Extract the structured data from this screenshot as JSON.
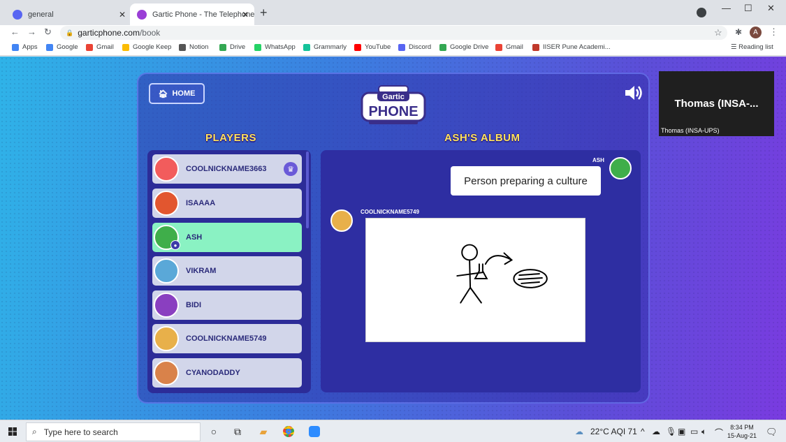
{
  "browser": {
    "tabs": [
      {
        "title": "general",
        "icon_color": "#5865f2",
        "active": false
      },
      {
        "title": "Gartic Phone - The Telephone Ga",
        "icon_color": "#9a3fd6",
        "active": true
      }
    ],
    "new_tab": "+",
    "url_host": "garticphone.com",
    "url_path": "/book",
    "profile_initial": "A",
    "bookmarks": [
      {
        "label": "Apps",
        "color": "#4285f4"
      },
      {
        "label": "Google",
        "color": "#4285f4"
      },
      {
        "label": "Gmail",
        "color": "#ea4335"
      },
      {
        "label": "Google Keep",
        "color": "#fbbc04"
      },
      {
        "label": "Notion",
        "color": "#555555"
      },
      {
        "label": "Drive",
        "color": "#34a853"
      },
      {
        "label": "WhatsApp",
        "color": "#25d366"
      },
      {
        "label": "Grammarly",
        "color": "#15c39a"
      },
      {
        "label": "YouTube",
        "color": "#ff0000"
      },
      {
        "label": "Discord",
        "color": "#5865f2"
      },
      {
        "label": "Google Drive",
        "color": "#34a853"
      },
      {
        "label": "Gmail",
        "color": "#ea4335"
      },
      {
        "label": "IISER Pune Academi...",
        "color": "#c0392b"
      }
    ],
    "reading_list": "Reading list"
  },
  "game": {
    "home_label": "HOME",
    "logo_top": "Gartic",
    "logo_bottom": "PHONE",
    "players_heading": "PLAYERS",
    "album_heading": "ASH'S ALBUM",
    "players": [
      {
        "name": "COOLNICKNAME3663",
        "avatar_color": "#f25c5c",
        "host": true
      },
      {
        "name": "ISAAAA",
        "avatar_color": "#e2562f"
      },
      {
        "name": "ASH",
        "avatar_color": "#3fae4a",
        "you": true
      },
      {
        "name": "VIKRAM",
        "avatar_color": "#5aa8d8"
      },
      {
        "name": "BIDI",
        "avatar_color": "#8a3fc0"
      },
      {
        "name": "COOLNICKNAME5749",
        "avatar_color": "#e8b04a"
      },
      {
        "name": "CYANODADDY",
        "avatar_color": "#d9824a"
      }
    ],
    "album": {
      "prompt_author": "ASH",
      "prompt_text": "Person preparing a culture",
      "drawing_author": "COOLNICKNAME5749"
    }
  },
  "video": {
    "name": "Thomas (INSA-...",
    "caption": "Thomas (INSA-UPS)"
  },
  "taskbar": {
    "search_placeholder": "Type here to search",
    "weather": "22°C AQI 71",
    "time": "8:34 PM",
    "date": "15-Aug-21"
  }
}
